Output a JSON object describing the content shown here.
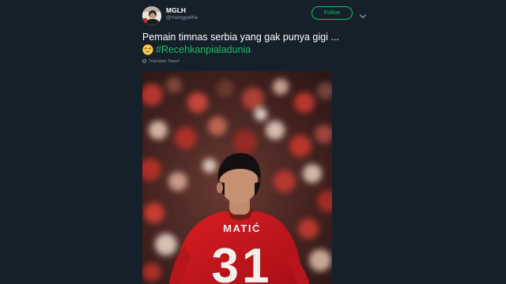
{
  "user": {
    "display_name": "MGLH",
    "handle": "@manggalihe"
  },
  "follow_label": "Follow",
  "tweet": {
    "text_line1": "Pemain timnas serbia  yang gak punya gigi ...",
    "hashtag": "#Recehkanpialadunia",
    "translate_label": "Translate Tweet"
  },
  "photo": {
    "jersey_name": "MATIĆ",
    "jersey_number": "31"
  },
  "icons": {
    "avatar": "user-avatar",
    "caret": "chevron-down-icon",
    "emoji": "grinning-emoji-icon",
    "globe": "globe-icon"
  },
  "colors": {
    "background": "#15202b",
    "accent": "#17bf63",
    "muted": "#8899a6",
    "jersey": "#c8161d"
  }
}
